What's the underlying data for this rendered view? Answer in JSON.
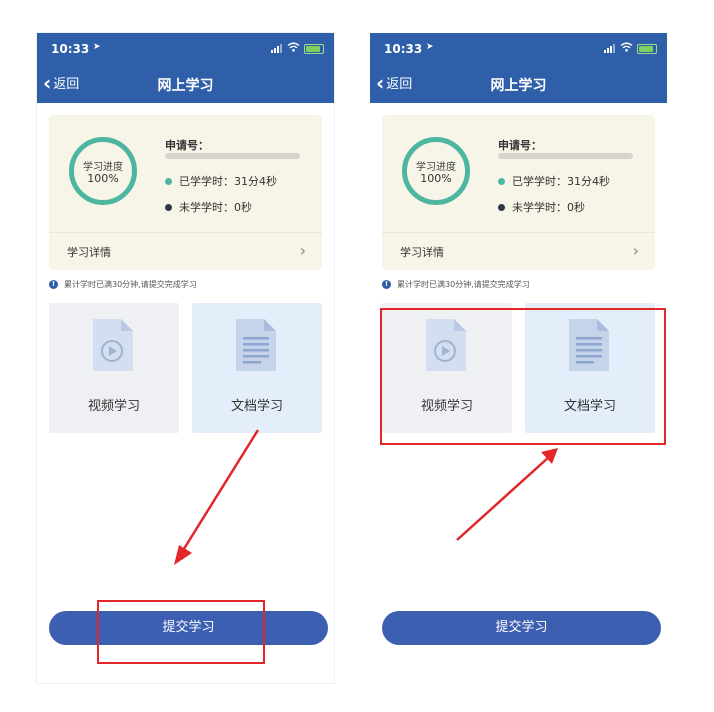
{
  "phones": [
    {
      "status": {
        "time": "10:33"
      },
      "nav": {
        "back_label": "返回",
        "title": "网上学习"
      },
      "progress": {
        "ring_title": "学习进度",
        "ring_value": "100%",
        "apply_label": "申请号：",
        "studied": "已学学时：31分4秒",
        "unstudied": "未学学时：0秒",
        "detail_label": "学习详情"
      },
      "notice": "累计学时已满30分钟,请提交完成学习",
      "tiles": {
        "video_label": "视频学习",
        "doc_label": "文档学习"
      },
      "submit_label": "提交学习"
    },
    {
      "status": {
        "time": "10:33"
      },
      "nav": {
        "back_label": "返回",
        "title": "网上学习"
      },
      "progress": {
        "ring_title": "学习进度",
        "ring_value": "100%",
        "apply_label": "申请号：",
        "studied": "已学学时：31分4秒",
        "unstudied": "未学学时：0秒",
        "detail_label": "学习详情"
      },
      "notice": "累计学时已满30分钟,请提交完成学习",
      "tiles": {
        "video_label": "视频学习",
        "doc_label": "文档学习"
      },
      "submit_label": "提交学习"
    }
  ],
  "colors": {
    "header": "#2f5fa8",
    "ring": "#4db6a1",
    "studied_dot": "#4db6a1",
    "unstudied_dot": "#2e3848",
    "submit": "#3d5fb2",
    "annotation": "#e2262a"
  },
  "icons": [
    "location-arrow-icon",
    "signal-icon",
    "wifi-icon",
    "battery-icon",
    "back-chevron-icon",
    "chevron-right-icon",
    "info-icon",
    "video-file-icon",
    "document-file-icon"
  ]
}
